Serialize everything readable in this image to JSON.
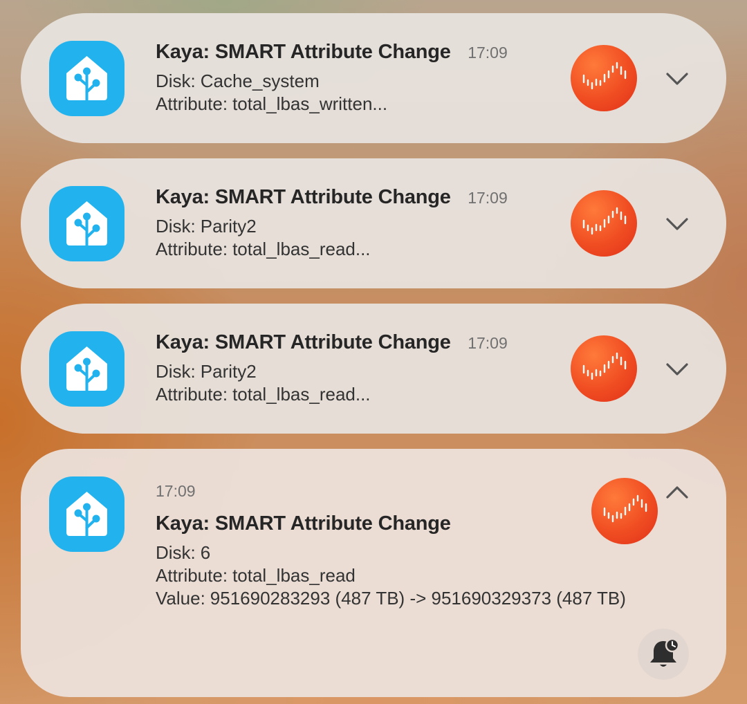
{
  "notifications": [
    {
      "title": "Kaya: SMART Attribute Change",
      "time": "17:09",
      "disk_label": "Disk:",
      "disk_value": "Cache_system",
      "attr_label": "Attribute:",
      "attr_value": "total_lbas_written..."
    },
    {
      "title": "Kaya: SMART Attribute Change",
      "time": "17:09",
      "disk_label": "Disk:",
      "disk_value": "Parity2",
      "attr_label": "Attribute:",
      "attr_value": "total_lbas_read..."
    },
    {
      "title": "Kaya: SMART Attribute Change",
      "time": "17:09",
      "disk_label": "Disk:",
      "disk_value": "Parity2",
      "attr_label": "Attribute:",
      "attr_value": "total_lbas_read..."
    }
  ],
  "expanded": {
    "time": "17:09",
    "title": "Kaya: SMART Attribute Change",
    "disk_label": "Disk:",
    "disk_value": "6",
    "attr_label": "Attribute:",
    "attr_value": "total_lbas_read",
    "value_label": "Value:",
    "value_value": "951690283293 (487 TB) -> 951690329373 (487 TB)"
  },
  "icons": {
    "app": "home-assistant-icon",
    "large": "grafana-icon",
    "expand": "chevron-down-icon",
    "collapse": "chevron-up-icon",
    "snooze": "bell-snooze-icon"
  },
  "colors": {
    "app_icon_bg": "#22b3ee",
    "grafana_orange": "#f04d22",
    "card_bg": "#e8e2de"
  }
}
